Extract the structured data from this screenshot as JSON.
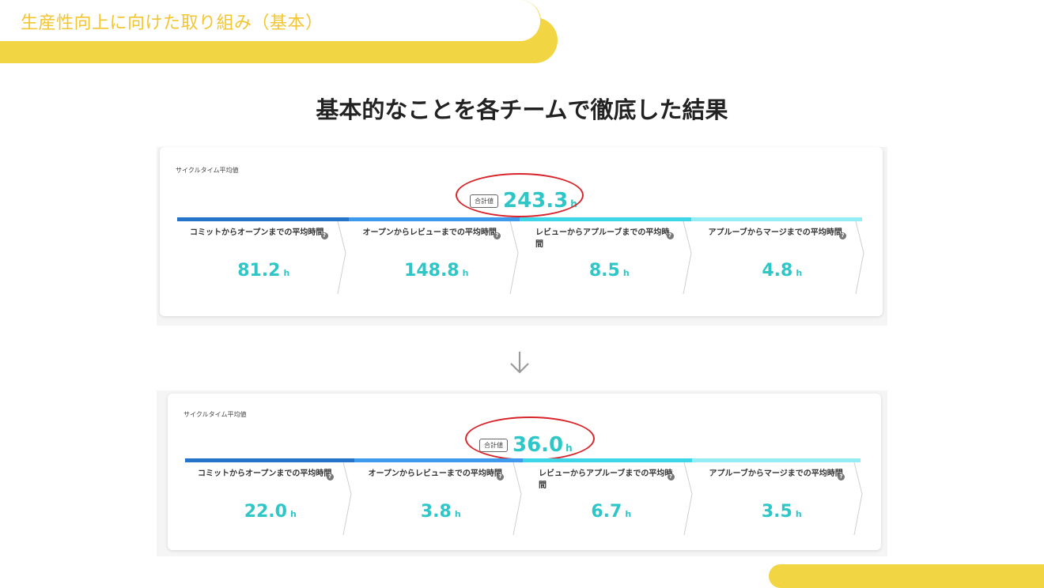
{
  "header": {
    "tab_title": "生産性向上に向けた取り組み（基本）"
  },
  "headline": "基本的なことを各チームで徹底した結果",
  "colors": {
    "accent_yellow": "#f2d542",
    "value_teal": "#2ec6c6",
    "highlight_red": "#d9232a",
    "bar_colors": [
      "#2475c9",
      "#3d9aec",
      "#3dd6e6",
      "#94ecf5"
    ]
  },
  "arrow_icon": "arrow-down-icon",
  "before": {
    "label": "サイクルタイム平均値",
    "total_badge": "合計値",
    "total_value": "243.3",
    "total_unit": "h",
    "stages": [
      {
        "label": "コミットからオープンまでの平均時間",
        "value": "81.2",
        "unit": "h",
        "help": "?"
      },
      {
        "label": "オープンからレビューまでの平均時間",
        "value": "148.8",
        "unit": "h",
        "help": "?"
      },
      {
        "label": "レビューからアプルーブまでの平均時間",
        "value": "8.5",
        "unit": "h",
        "help": "?"
      },
      {
        "label": "アプルーブからマージまでの平均時間",
        "value": "4.8",
        "unit": "h",
        "help": "?"
      }
    ]
  },
  "after": {
    "label": "サイクルタイム平均値",
    "total_badge": "合計値",
    "total_value": "36.0",
    "total_unit": "h",
    "stages": [
      {
        "label": "コミットからオープンまでの平均時間",
        "value": "22.0",
        "unit": "h",
        "help": "?"
      },
      {
        "label": "オープンからレビューまでの平均時間",
        "value": "3.8",
        "unit": "h",
        "help": "?"
      },
      {
        "label": "レビューからアプルーブまでの平均時間",
        "value": "6.7",
        "unit": "h",
        "help": "?"
      },
      {
        "label": "アプルーブからマージまでの平均時間",
        "value": "3.5",
        "unit": "h",
        "help": "?"
      }
    ]
  }
}
